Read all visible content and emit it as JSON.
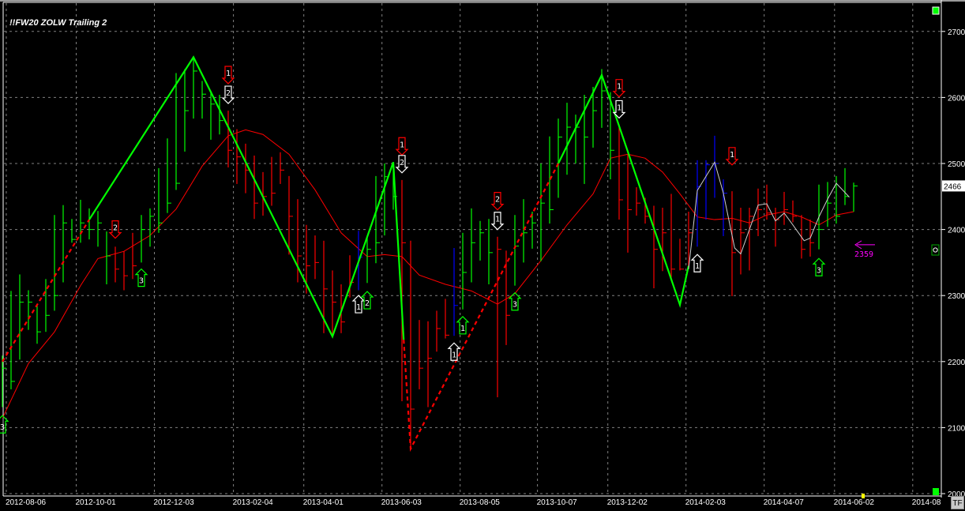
{
  "title": "!!FW20 ZOLW Trailing 2",
  "tf_button": "TF",
  "colors": {
    "up": "#00ff00",
    "down": "#ff0000",
    "neutral": "#0000ff",
    "ma": "#ff0000",
    "zigzag": "#00ff00",
    "zigzag_dashed": "#ff0000",
    "swing": "#d0d0d0",
    "target": "#ff00ff"
  },
  "chart_data": {
    "type": "ohlc",
    "title": "!!FW20 ZOLW Trailing 2",
    "ylim": [
      2000,
      2700
    ],
    "yticks": [
      2000,
      2100,
      2200,
      2300,
      2400,
      2500,
      2600,
      2700
    ],
    "ytick_labels": [
      "2000",
      "2100",
      "2200",
      "2300",
      "2400",
      "2500",
      "2600",
      "2700"
    ],
    "last_price": 2466,
    "last_price_label": "2466",
    "x_unit": "weekly bar index",
    "xlim": [
      0,
      107
    ],
    "xticks": [
      {
        "bar": 0.45,
        "label": "2012-08-06"
      },
      {
        "bar": 8.5,
        "label": "2012-10-01"
      },
      {
        "bar": 17.5,
        "label": "2012-12-03"
      },
      {
        "bar": 26.6,
        "label": "2013-02-04"
      },
      {
        "bar": 34.7,
        "label": "2013-04-01"
      },
      {
        "bar": 43.7,
        "label": "2013-06-03"
      },
      {
        "bar": 52.7,
        "label": "2013-08-05"
      },
      {
        "bar": 61.6,
        "label": "2013-10-07"
      },
      {
        "bar": 69.7,
        "label": "2013-12-02"
      },
      {
        "bar": 78.7,
        "label": "2014-02-03"
      },
      {
        "bar": 87.7,
        "label": "2014-04-07"
      },
      {
        "bar": 95.8,
        "label": "2014-06-02"
      },
      {
        "bar": 104.8,
        "label": "2014-08"
      }
    ],
    "bars_fields": [
      "high",
      "low",
      "close",
      "color"
    ],
    "bars": [
      [
        2209,
        2131,
        2190,
        "g"
      ],
      [
        2307,
        2158,
        2170,
        "g"
      ],
      [
        2332,
        2203,
        2290,
        "g"
      ],
      [
        2308,
        2248,
        2290,
        "g"
      ],
      [
        2287,
        2227,
        2245,
        "g"
      ],
      [
        2325,
        2245,
        2270,
        "g"
      ],
      [
        2422,
        2277,
        2300,
        "g"
      ],
      [
        2437,
        2320,
        2410,
        "g"
      ],
      [
        2416,
        2380,
        2385,
        "g"
      ],
      [
        2445,
        2380,
        2410,
        "g"
      ],
      [
        2432,
        2385,
        2400,
        "g"
      ],
      [
        2428,
        2374,
        2410,
        "g"
      ],
      [
        2397,
        2317,
        2360,
        "g"
      ],
      [
        2374,
        2320,
        2340,
        "r"
      ],
      [
        2367,
        2308,
        2330,
        "r"
      ],
      [
        2395,
        2325,
        2345,
        "r"
      ],
      [
        2422,
        2350,
        2400,
        "g"
      ],
      [
        2432,
        2374,
        2420,
        "g"
      ],
      [
        2493,
        2395,
        2410,
        "g"
      ],
      [
        2538,
        2425,
        2440,
        "g"
      ],
      [
        2637,
        2460,
        2470,
        "g"
      ],
      [
        2643,
        2518,
        2580,
        "g"
      ],
      [
        2661,
        2568,
        2640,
        "g"
      ],
      [
        2625,
        2568,
        2605,
        "g"
      ],
      [
        2610,
        2536,
        2590,
        "g"
      ],
      [
        2604,
        2544,
        2565,
        "g"
      ],
      [
        2580,
        2494,
        2520,
        "r"
      ],
      [
        2552,
        2469,
        2510,
        "r"
      ],
      [
        2530,
        2455,
        2490,
        "r"
      ],
      [
        2512,
        2416,
        2440,
        "r"
      ],
      [
        2487,
        2421,
        2450,
        "r"
      ],
      [
        2510,
        2436,
        2455,
        "r"
      ],
      [
        2517,
        2469,
        2490,
        "r"
      ],
      [
        2481,
        2362,
        2420,
        "r"
      ],
      [
        2446,
        2320,
        2360,
        "r"
      ],
      [
        2407,
        2303,
        2345,
        "r"
      ],
      [
        2391,
        2325,
        2350,
        "r"
      ],
      [
        2383,
        2243,
        2310,
        "r"
      ],
      [
        2338,
        2237,
        2290,
        "r"
      ],
      [
        2317,
        2243,
        2260,
        "r"
      ],
      [
        2361,
        2297,
        2320,
        "r"
      ],
      [
        2398,
        2308,
        2358,
        "b"
      ],
      [
        2389,
        2319,
        2370,
        "g"
      ],
      [
        2481,
        2349,
        2380,
        "g"
      ],
      [
        2500,
        2391,
        2480,
        "g"
      ],
      [
        2500,
        2430,
        2450,
        "g"
      ],
      [
        2475,
        2140,
        2380,
        "r"
      ],
      [
        2383,
        2066,
        2128,
        "r"
      ],
      [
        2263,
        2158,
        2190,
        "r"
      ],
      [
        2261,
        2131,
        2205,
        "r"
      ],
      [
        2277,
        2215,
        2250,
        "r"
      ],
      [
        2295,
        2235,
        2240,
        "r"
      ],
      [
        2372,
        2239,
        2285,
        "b"
      ],
      [
        2395,
        2279,
        2335,
        "g"
      ],
      [
        2432,
        2320,
        2380,
        "g"
      ],
      [
        2413,
        2353,
        2395,
        "g"
      ],
      [
        2416,
        2317,
        2365,
        "g"
      ],
      [
        2389,
        2146,
        2370,
        "r"
      ],
      [
        2368,
        2225,
        2270,
        "r"
      ],
      [
        2422,
        2315,
        2375,
        "g"
      ],
      [
        2446,
        2350,
        2395,
        "g"
      ],
      [
        2427,
        2371,
        2410,
        "g"
      ],
      [
        2500,
        2352,
        2440,
        "g"
      ],
      [
        2541,
        2409,
        2430,
        "g"
      ],
      [
        2568,
        2448,
        2540,
        "g"
      ],
      [
        2592,
        2483,
        2555,
        "g"
      ],
      [
        2574,
        2500,
        2555,
        "g"
      ],
      [
        2604,
        2469,
        2540,
        "g"
      ],
      [
        2616,
        2524,
        2580,
        "g"
      ],
      [
        2643,
        2554,
        2610,
        "g"
      ],
      [
        2608,
        2476,
        2520,
        "g"
      ],
      [
        2556,
        2415,
        2445,
        "r"
      ],
      [
        2514,
        2365,
        2430,
        "r"
      ],
      [
        2464,
        2421,
        2440,
        "r"
      ],
      [
        2448,
        2409,
        2420,
        "r"
      ],
      [
        2436,
        2311,
        2370,
        "r"
      ],
      [
        2433,
        2337,
        2395,
        "r"
      ],
      [
        2454,
        2325,
        2340,
        "r"
      ],
      [
        2386,
        2338,
        2340,
        "r"
      ],
      [
        2427,
        2341,
        2395,
        "r"
      ],
      [
        2505,
        2374,
        2465,
        "b"
      ],
      [
        2505,
        2415,
        2498,
        "b"
      ],
      [
        2542,
        2448,
        2500,
        "b"
      ],
      [
        2476,
        2390,
        2455,
        "b"
      ],
      [
        2458,
        2299,
        2365,
        "r"
      ],
      [
        2433,
        2332,
        2395,
        "r"
      ],
      [
        2433,
        2338,
        2420,
        "r"
      ],
      [
        2462,
        2390,
        2430,
        "r"
      ],
      [
        2468,
        2415,
        2425,
        "r"
      ],
      [
        2433,
        2374,
        2415,
        "r"
      ],
      [
        2457,
        2407,
        2430,
        "r"
      ],
      [
        2444,
        2411,
        2420,
        "r"
      ],
      [
        2422,
        2356,
        2370,
        "r"
      ],
      [
        2415,
        2359,
        2380,
        "r"
      ],
      [
        2468,
        2370,
        2400,
        "g"
      ],
      [
        2472,
        2404,
        2440,
        "g"
      ],
      [
        2481,
        2409,
        2420,
        "g"
      ],
      [
        2493,
        2437,
        2450,
        "g"
      ],
      [
        2471,
        2427,
        2466,
        "g"
      ]
    ],
    "moving_average": [
      [
        0,
        2114
      ],
      [
        3,
        2197
      ],
      [
        6,
        2245
      ],
      [
        9,
        2315
      ],
      [
        11,
        2356
      ],
      [
        14,
        2367
      ],
      [
        17,
        2391
      ],
      [
        20,
        2431
      ],
      [
        23,
        2496
      ],
      [
        26,
        2542
      ],
      [
        28,
        2551
      ],
      [
        30,
        2544
      ],
      [
        33,
        2514
      ],
      [
        36,
        2460
      ],
      [
        39,
        2395
      ],
      [
        42,
        2359
      ],
      [
        44,
        2362
      ],
      [
        46,
        2359
      ],
      [
        48,
        2331
      ],
      [
        51,
        2317
      ],
      [
        54,
        2307
      ],
      [
        57,
        2287
      ],
      [
        59,
        2303
      ],
      [
        62,
        2353
      ],
      [
        65,
        2407
      ],
      [
        68,
        2454
      ],
      [
        70,
        2508
      ],
      [
        72,
        2514
      ],
      [
        74,
        2508
      ],
      [
        76,
        2487
      ],
      [
        78,
        2454
      ],
      [
        80,
        2419
      ],
      [
        82,
        2415
      ],
      [
        84,
        2417
      ],
      [
        86,
        2410
      ],
      [
        88,
        2422
      ],
      [
        90,
        2427
      ],
      [
        92,
        2419
      ],
      [
        94,
        2407
      ],
      [
        96,
        2422
      ],
      [
        98,
        2427
      ]
    ],
    "zigzag": [
      {
        "style": "dashed",
        "points": [
          [
            0,
            2200
          ],
          [
            10,
            2415
          ]
        ]
      },
      {
        "style": "solid",
        "points": [
          [
            10,
            2415
          ],
          [
            22,
            2661
          ],
          [
            38,
            2238
          ],
          [
            45,
            2502
          ],
          [
            46.2,
            2233
          ]
        ]
      },
      {
        "style": "dashed",
        "points": [
          [
            46.2,
            2233
          ],
          [
            47,
            2068
          ],
          [
            64,
            2500
          ]
        ]
      },
      {
        "style": "solid",
        "points": [
          [
            64,
            2500
          ],
          [
            69,
            2634
          ],
          [
            78,
            2286
          ],
          [
            79,
            2345
          ]
        ]
      }
    ],
    "swing_line": [
      [
        79,
        2340
      ],
      [
        80,
        2459
      ],
      [
        82,
        2502
      ],
      [
        83,
        2455
      ],
      [
        84.3,
        2372
      ],
      [
        85,
        2363
      ],
      [
        87,
        2437
      ],
      [
        88,
        2439
      ],
      [
        89,
        2413
      ],
      [
        90,
        2425
      ],
      [
        91,
        2407
      ],
      [
        92.3,
        2383
      ],
      [
        93,
        2387
      ],
      [
        94,
        2419
      ],
      [
        95,
        2446
      ],
      [
        96,
        2470
      ],
      [
        97.5,
        2449
      ]
    ],
    "signals": [
      {
        "bar": 0,
        "price": 2105,
        "dir": "up",
        "color": "#00ff00",
        "label": "3"
      },
      {
        "bar": 13,
        "price": 2400,
        "dir": "down",
        "color": "#ff0000",
        "label": "2"
      },
      {
        "bar": 16,
        "price": 2327,
        "dir": "up",
        "color": "#00ff00",
        "label": "3"
      },
      {
        "bar": 26,
        "price": 2634,
        "dir": "down",
        "color": "#ff0000",
        "label": "1"
      },
      {
        "bar": 26,
        "price": 2604,
        "dir": "down",
        "color": "#ffffff",
        "label": "2"
      },
      {
        "bar": 41,
        "price": 2287,
        "dir": "up",
        "color": "#ffffff",
        "label": "1"
      },
      {
        "bar": 42,
        "price": 2293,
        "dir": "up",
        "color": "#00ff00",
        "label": "2"
      },
      {
        "bar": 46,
        "price": 2526,
        "dir": "down",
        "color": "#ff0000",
        "label": "1"
      },
      {
        "bar": 46,
        "price": 2499,
        "dir": "down",
        "color": "#ffffff",
        "label": "2"
      },
      {
        "bar": 52,
        "price": 2215,
        "dir": "up",
        "color": "#ffffff",
        "label": "1"
      },
      {
        "bar": 53,
        "price": 2255,
        "dir": "up",
        "color": "#00ff00",
        "label": "1"
      },
      {
        "bar": 57,
        "price": 2443,
        "dir": "down",
        "color": "#ff0000",
        "label": "2"
      },
      {
        "bar": 57,
        "price": 2413,
        "dir": "down",
        "color": "#ffffff",
        "label": "1"
      },
      {
        "bar": 59,
        "price": 2291,
        "dir": "up",
        "color": "#00ff00",
        "label": "3"
      },
      {
        "bar": 71,
        "price": 2614,
        "dir": "down",
        "color": "#ff0000",
        "label": "1"
      },
      {
        "bar": 71,
        "price": 2582,
        "dir": "down",
        "color": "#ffffff",
        "label": "1"
      },
      {
        "bar": 80,
        "price": 2349,
        "dir": "up",
        "color": "#ffffff",
        "label": "1"
      },
      {
        "bar": 84,
        "price": 2511,
        "dir": "down",
        "color": "#ff0000",
        "label": "1"
      },
      {
        "bar": 94,
        "price": 2343,
        "dir": "up",
        "color": "#00ff00",
        "label": "3"
      }
    ],
    "target": {
      "price": 2359,
      "label": "2359"
    }
  }
}
